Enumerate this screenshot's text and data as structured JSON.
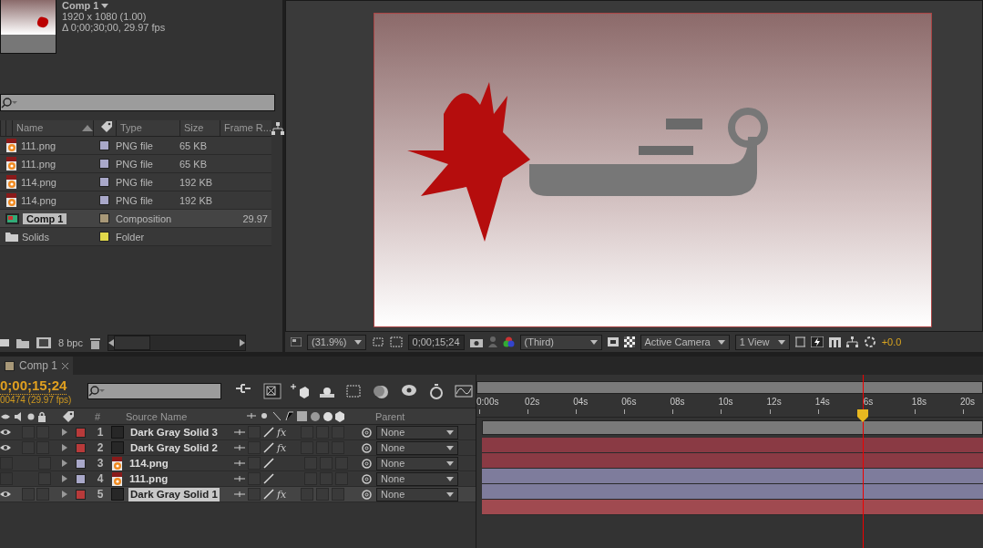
{
  "project": {
    "comp_name": "Comp 1",
    "resolution": "1920 x 1080 (1.00)",
    "duration": "Δ 0;00;30;00, 29.97 fps",
    "columns": [
      "Name",
      "Type",
      "Size",
      "Frame R..."
    ],
    "items": [
      {
        "kind": "png",
        "name": "111.png",
        "color": "#a9a8c9",
        "type": "PNG file",
        "size": "65 KB",
        "selected": false
      },
      {
        "kind": "png",
        "name": "111.png",
        "color": "#a9a8c9",
        "type": "PNG file",
        "size": "65 KB",
        "selected": false
      },
      {
        "kind": "png",
        "name": "114.png",
        "color": "#a9a8c9",
        "type": "PNG file",
        "size": "192 KB",
        "selected": false
      },
      {
        "kind": "png",
        "name": "114.png",
        "color": "#a9a8c9",
        "type": "PNG file",
        "size": "192 KB",
        "selected": false
      },
      {
        "kind": "comp",
        "name": "Comp 1",
        "color": "#a89878",
        "type": "Composition",
        "frame_rate": "29.97",
        "selected": true
      },
      {
        "kind": "folder",
        "name": "Solids",
        "color": "#e0d84a",
        "type": "Folder",
        "selected": false
      }
    ],
    "bit_depth": "8 bpc"
  },
  "viewer": {
    "magnification": "(31.9%)",
    "timecode": "0;00;15;24",
    "view": "(Third)",
    "camera": "Active Camera",
    "layout": "1 View",
    "exposure": "+0.0"
  },
  "timeline": {
    "tab": {
      "title": "Comp 1",
      "color": "#a89878"
    },
    "timecode": "0;00;15;24",
    "frame_info": "00474 (29.97 fps)",
    "columns": [
      "#",
      "Source Name",
      "Parent"
    ],
    "ruler": [
      "0:00s",
      "02s",
      "04s",
      "06s",
      "08s",
      "10s",
      "12s",
      "14s",
      "6s",
      "18s",
      "20s"
    ],
    "playhead": {
      "level": 0.763
    },
    "layers": [
      {
        "kind": "solid",
        "number": "1",
        "name": "Dark Gray Solid 3",
        "color": "#b83a3a",
        "visible": true,
        "effects": "fx",
        "parent": "None",
        "selected": false
      },
      {
        "kind": "solid",
        "number": "2",
        "name": "Dark Gray Solid 2",
        "color": "#b83a3a",
        "visible": true,
        "effects": "fx",
        "parent": "None",
        "selected": false
      },
      {
        "kind": "png",
        "number": "3",
        "name": "114.png",
        "color": "#a9a8c9",
        "visible": false,
        "parent": "None",
        "selected": false
      },
      {
        "kind": "png",
        "number": "4",
        "name": "111.png",
        "color": "#a9a8c9",
        "visible": false,
        "parent": "None",
        "selected": false
      },
      {
        "kind": "solid",
        "number": "5",
        "name": "Dark Gray Solid 1",
        "color": "#b83a3a",
        "visible": true,
        "effects": "fx",
        "parent": "None",
        "selected": true
      }
    ]
  }
}
